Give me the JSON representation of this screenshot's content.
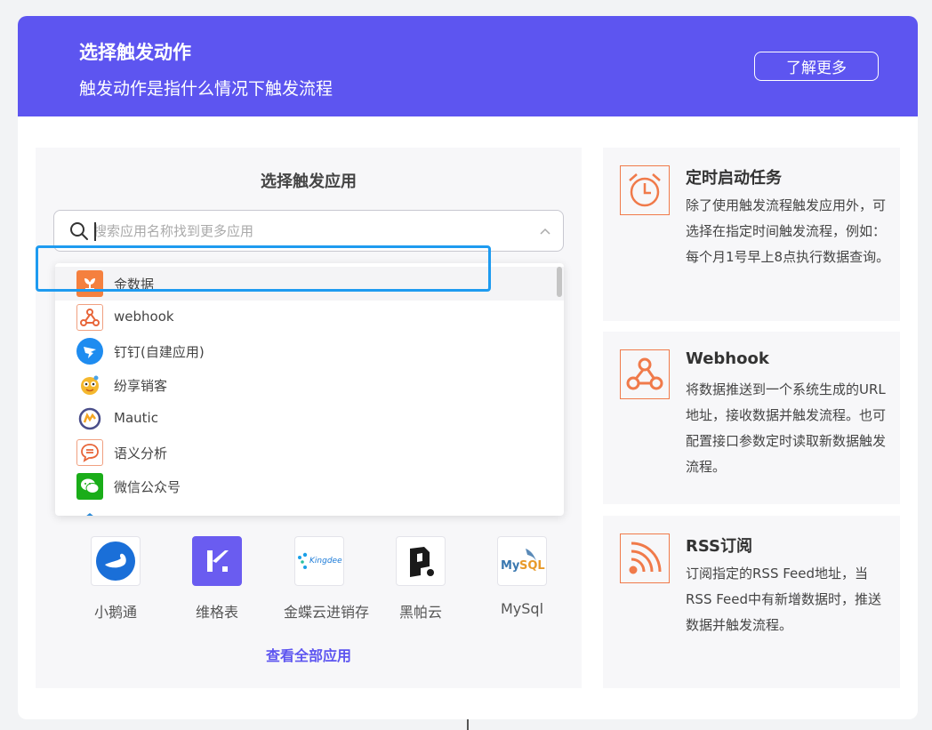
{
  "header": {
    "title": "选择触发动作",
    "subtitle": "触发动作是指什么情况下触发流程",
    "learn_more": "了解更多"
  },
  "trigger_app": {
    "title": "选择触发应用",
    "search_placeholder": "搜索应用名称找到更多应用",
    "dropdown_items": [
      {
        "label": "金数据",
        "icon": "jinshuju-icon"
      },
      {
        "label": "webhook",
        "icon": "webhook-icon"
      },
      {
        "label": "钉钉(自建应用)",
        "icon": "dingtalk-icon"
      },
      {
        "label": "纷享销客",
        "icon": "fxiaoke-icon"
      },
      {
        "label": "Mautic",
        "icon": "mautic-icon"
      },
      {
        "label": "语义分析",
        "icon": "semantic-analysis-icon"
      },
      {
        "label": "微信公众号",
        "icon": "wechat-icon"
      }
    ],
    "apps": [
      {
        "label": "小鹅通",
        "icon": "xiaoetong-icon"
      },
      {
        "label": "维格表",
        "icon": "vika-icon"
      },
      {
        "label": "金蝶云进销存",
        "icon": "kingdee-icon"
      },
      {
        "label": "黑帕云",
        "icon": "hipacloud-icon"
      },
      {
        "label": "MySql",
        "icon": "mysql-icon"
      }
    ],
    "view_all": "查看全部应用"
  },
  "side_cards": [
    {
      "title": "定时启动任务",
      "description": "除了使用触发流程触发应用外，可选择在指定时间触发流程，例如：每个月1号早上8点执行数据查询。",
      "icon": "alarm-clock-icon"
    },
    {
      "title": "Webhook",
      "description": "将数据推送到一个系统生成的URL地址，接收数据并触发流程。也可配置接口参数定时读取新数据触发流程。",
      "icon": "webhook-icon"
    },
    {
      "title": "RSS订阅",
      "description": "订阅指定的RSS Feed地址，当RSS Feed中有新增数据时，推送数据并触发流程。",
      "icon": "rss-icon"
    }
  ],
  "colors": {
    "header_bg": "#5d55f0",
    "accent": "#5d55f0",
    "highlight_border": "#1e9bf0",
    "icon_orange": "#f07a4a"
  }
}
